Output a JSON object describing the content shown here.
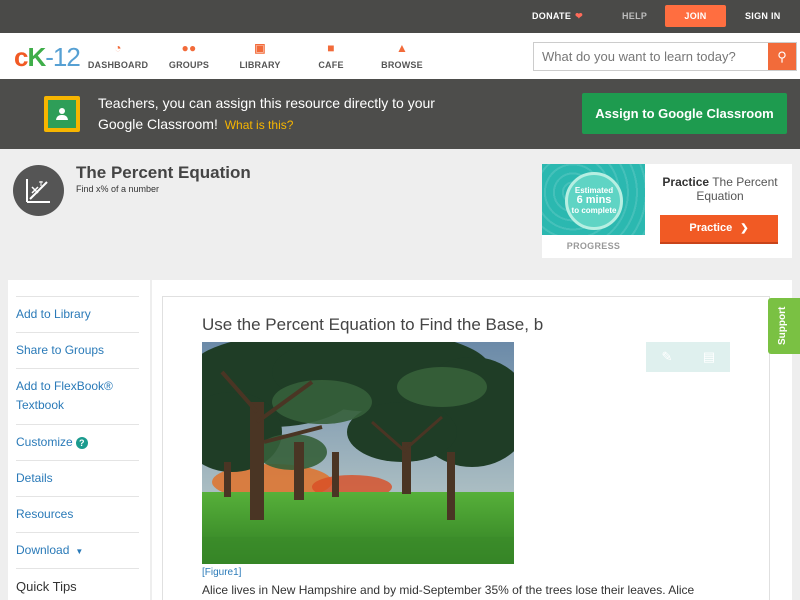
{
  "topbar": {
    "donate": "DONATE",
    "help": "HELP",
    "join": "JOIN",
    "signin": "SIGN IN"
  },
  "nav": {
    "logo_c": "c",
    "logo_k": "K",
    "logo_n": "-12",
    "items": [
      {
        "label": "DASHBOARD",
        "icon": "dashboard-icon"
      },
      {
        "label": "GROUPS",
        "icon": "groups-icon"
      },
      {
        "label": "LIBRARY",
        "icon": "library-icon"
      },
      {
        "label": "CAFE",
        "icon": "cafe-icon"
      },
      {
        "label": "BROWSE",
        "icon": "browse-icon"
      }
    ],
    "search_placeholder": "What do you want to learn today?"
  },
  "banner": {
    "text": "Teachers, you can assign this resource directly to your Google Classroom!",
    "what": "What is this?",
    "assign": "Assign to Google Classroom"
  },
  "header": {
    "title": "The Percent Equation",
    "subtitle": "Find x% of a number"
  },
  "practice_card": {
    "estimated": "Estimated",
    "mins": "6 mins",
    "complete": "to complete",
    "progress": "PROGRESS",
    "practice_bold": "Practice",
    "practice_rest": "The Percent Equation",
    "button": "Practice"
  },
  "sidebar": {
    "items": [
      {
        "label": "Add to Library"
      },
      {
        "label": "Share to Groups"
      },
      {
        "label": "Add to FlexBook® Textbook"
      },
      {
        "label": "Customize"
      },
      {
        "label": "Details"
      },
      {
        "label": "Resources"
      },
      {
        "label": "Download"
      },
      {
        "label": "Quick Tips"
      }
    ]
  },
  "content": {
    "section_title": "Use the Percent Equation to Find the Base, b",
    "figure_caption": "[Figure1]",
    "paragraph": "Alice lives in New Hampshire and by mid-September 35% of the trees lose their leaves. Alice"
  },
  "support": "Support",
  "colors": {
    "brand_orange": "#f15a24",
    "google_green": "#1e9b4f",
    "teal": "#2bb8b0",
    "support_green": "#7ac143"
  }
}
